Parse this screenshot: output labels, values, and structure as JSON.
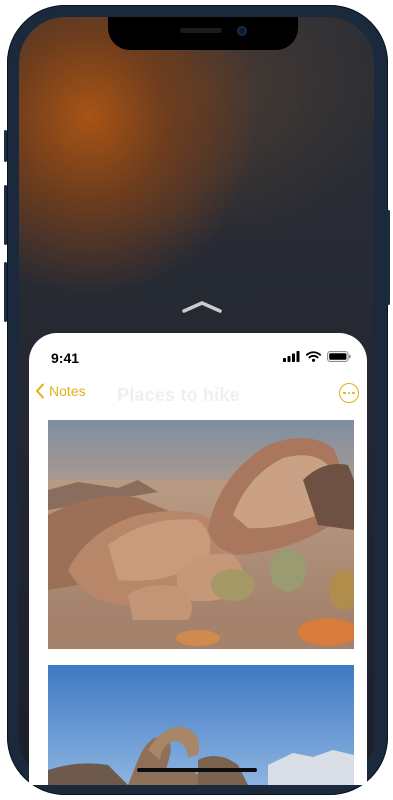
{
  "device": {
    "frame_color": "#1a2a3c"
  },
  "status_bar": {
    "time": "9:41",
    "icons": [
      "cellular-signal-icon",
      "wifi-icon",
      "battery-icon"
    ]
  },
  "notes_view": {
    "back_label": "Notes",
    "back_icon": "chevron-left-icon",
    "title": "Places to hike",
    "more_icon": "ellipsis-circle-icon",
    "accent_color": "#e3b013"
  },
  "home_indicator": {
    "up_arrow_icon": "chevron-up-icon"
  }
}
